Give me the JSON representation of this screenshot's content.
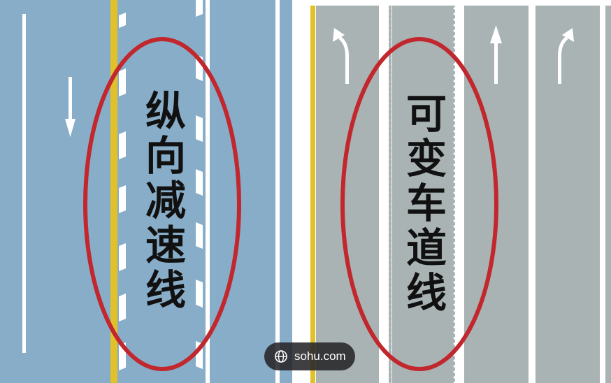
{
  "labels": {
    "left": "纵向减速线",
    "right": "可变车道线"
  },
  "watermark": {
    "text": "sohu.com",
    "icon": "globe-icon"
  },
  "icons": {
    "left_panel_arrow": "arrow-down-icon",
    "right_panel_arrows": [
      "turn-left-arrow-icon",
      "straight-arrow-icon",
      "turn-right-arrow-icon"
    ]
  },
  "colors": {
    "road_blue": "#88adc8",
    "road_gray": "#a9b3b4",
    "lane_yellow": "#e2c02a",
    "marking_white": "#ffffff",
    "ellipse_red": "#c1272d",
    "label_text": "#111111"
  }
}
